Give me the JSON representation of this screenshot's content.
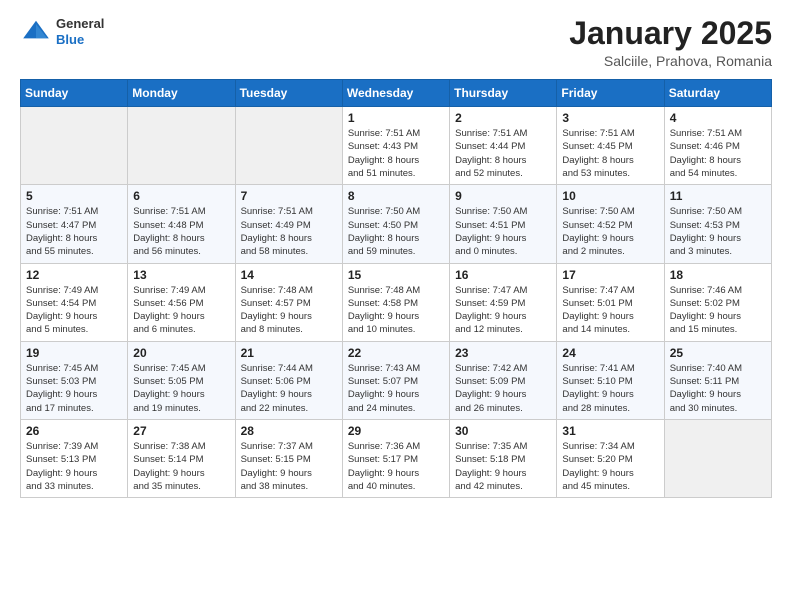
{
  "header": {
    "logo_general": "General",
    "logo_blue": "Blue",
    "month_title": "January 2025",
    "location": "Salciile, Prahova, Romania"
  },
  "weekdays": [
    "Sunday",
    "Monday",
    "Tuesday",
    "Wednesday",
    "Thursday",
    "Friday",
    "Saturday"
  ],
  "weeks": [
    [
      {
        "day": "",
        "info": ""
      },
      {
        "day": "",
        "info": ""
      },
      {
        "day": "",
        "info": ""
      },
      {
        "day": "1",
        "info": "Sunrise: 7:51 AM\nSunset: 4:43 PM\nDaylight: 8 hours\nand 51 minutes."
      },
      {
        "day": "2",
        "info": "Sunrise: 7:51 AM\nSunset: 4:44 PM\nDaylight: 8 hours\nand 52 minutes."
      },
      {
        "day": "3",
        "info": "Sunrise: 7:51 AM\nSunset: 4:45 PM\nDaylight: 8 hours\nand 53 minutes."
      },
      {
        "day": "4",
        "info": "Sunrise: 7:51 AM\nSunset: 4:46 PM\nDaylight: 8 hours\nand 54 minutes."
      }
    ],
    [
      {
        "day": "5",
        "info": "Sunrise: 7:51 AM\nSunset: 4:47 PM\nDaylight: 8 hours\nand 55 minutes."
      },
      {
        "day": "6",
        "info": "Sunrise: 7:51 AM\nSunset: 4:48 PM\nDaylight: 8 hours\nand 56 minutes."
      },
      {
        "day": "7",
        "info": "Sunrise: 7:51 AM\nSunset: 4:49 PM\nDaylight: 8 hours\nand 58 minutes."
      },
      {
        "day": "8",
        "info": "Sunrise: 7:50 AM\nSunset: 4:50 PM\nDaylight: 8 hours\nand 59 minutes."
      },
      {
        "day": "9",
        "info": "Sunrise: 7:50 AM\nSunset: 4:51 PM\nDaylight: 9 hours\nand 0 minutes."
      },
      {
        "day": "10",
        "info": "Sunrise: 7:50 AM\nSunset: 4:52 PM\nDaylight: 9 hours\nand 2 minutes."
      },
      {
        "day": "11",
        "info": "Sunrise: 7:50 AM\nSunset: 4:53 PM\nDaylight: 9 hours\nand 3 minutes."
      }
    ],
    [
      {
        "day": "12",
        "info": "Sunrise: 7:49 AM\nSunset: 4:54 PM\nDaylight: 9 hours\nand 5 minutes."
      },
      {
        "day": "13",
        "info": "Sunrise: 7:49 AM\nSunset: 4:56 PM\nDaylight: 9 hours\nand 6 minutes."
      },
      {
        "day": "14",
        "info": "Sunrise: 7:48 AM\nSunset: 4:57 PM\nDaylight: 9 hours\nand 8 minutes."
      },
      {
        "day": "15",
        "info": "Sunrise: 7:48 AM\nSunset: 4:58 PM\nDaylight: 9 hours\nand 10 minutes."
      },
      {
        "day": "16",
        "info": "Sunrise: 7:47 AM\nSunset: 4:59 PM\nDaylight: 9 hours\nand 12 minutes."
      },
      {
        "day": "17",
        "info": "Sunrise: 7:47 AM\nSunset: 5:01 PM\nDaylight: 9 hours\nand 14 minutes."
      },
      {
        "day": "18",
        "info": "Sunrise: 7:46 AM\nSunset: 5:02 PM\nDaylight: 9 hours\nand 15 minutes."
      }
    ],
    [
      {
        "day": "19",
        "info": "Sunrise: 7:45 AM\nSunset: 5:03 PM\nDaylight: 9 hours\nand 17 minutes."
      },
      {
        "day": "20",
        "info": "Sunrise: 7:45 AM\nSunset: 5:05 PM\nDaylight: 9 hours\nand 19 minutes."
      },
      {
        "day": "21",
        "info": "Sunrise: 7:44 AM\nSunset: 5:06 PM\nDaylight: 9 hours\nand 22 minutes."
      },
      {
        "day": "22",
        "info": "Sunrise: 7:43 AM\nSunset: 5:07 PM\nDaylight: 9 hours\nand 24 minutes."
      },
      {
        "day": "23",
        "info": "Sunrise: 7:42 AM\nSunset: 5:09 PM\nDaylight: 9 hours\nand 26 minutes."
      },
      {
        "day": "24",
        "info": "Sunrise: 7:41 AM\nSunset: 5:10 PM\nDaylight: 9 hours\nand 28 minutes."
      },
      {
        "day": "25",
        "info": "Sunrise: 7:40 AM\nSunset: 5:11 PM\nDaylight: 9 hours\nand 30 minutes."
      }
    ],
    [
      {
        "day": "26",
        "info": "Sunrise: 7:39 AM\nSunset: 5:13 PM\nDaylight: 9 hours\nand 33 minutes."
      },
      {
        "day": "27",
        "info": "Sunrise: 7:38 AM\nSunset: 5:14 PM\nDaylight: 9 hours\nand 35 minutes."
      },
      {
        "day": "28",
        "info": "Sunrise: 7:37 AM\nSunset: 5:15 PM\nDaylight: 9 hours\nand 38 minutes."
      },
      {
        "day": "29",
        "info": "Sunrise: 7:36 AM\nSunset: 5:17 PM\nDaylight: 9 hours\nand 40 minutes."
      },
      {
        "day": "30",
        "info": "Sunrise: 7:35 AM\nSunset: 5:18 PM\nDaylight: 9 hours\nand 42 minutes."
      },
      {
        "day": "31",
        "info": "Sunrise: 7:34 AM\nSunset: 5:20 PM\nDaylight: 9 hours\nand 45 minutes."
      },
      {
        "day": "",
        "info": ""
      }
    ]
  ]
}
